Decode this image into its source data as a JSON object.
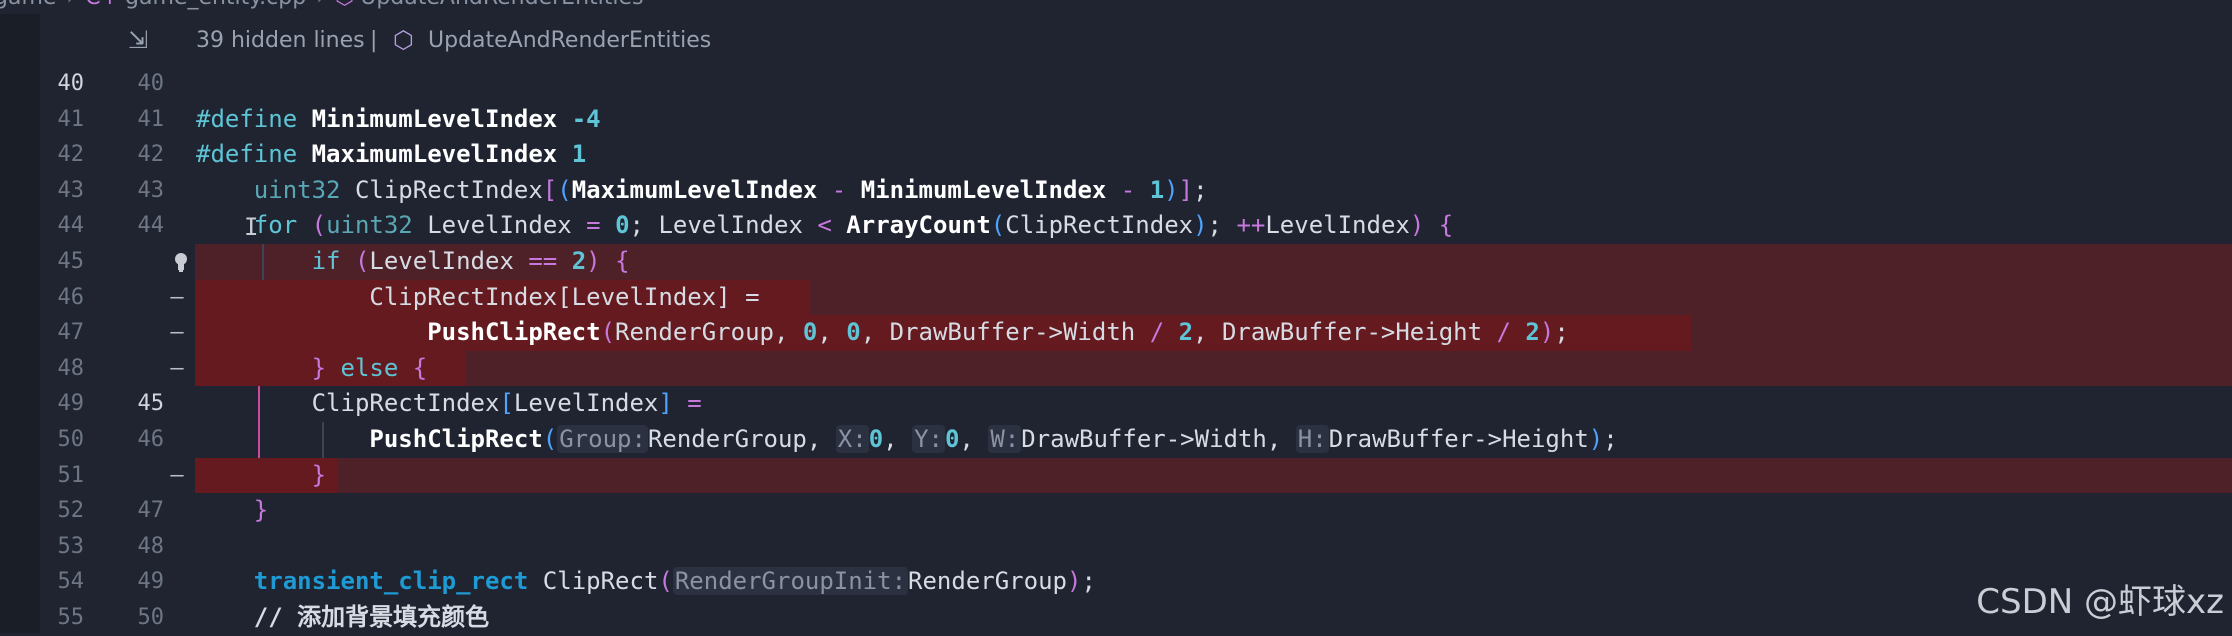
{
  "breadcrumb": {
    "folder": "game",
    "file": "game_entity.cpp",
    "symbol": "UpdateAndRenderEntities"
  },
  "sticky": {
    "hidden_lines": "39 hidden lines",
    "divider": "|",
    "function": "UpdateAndRenderEntities"
  },
  "lines": [
    {
      "left": "40",
      "right": "40"
    },
    {
      "left": "41",
      "right": "41"
    },
    {
      "left": "42",
      "right": "42"
    },
    {
      "left": "43",
      "right": "43"
    },
    {
      "left": "44",
      "right": "44"
    },
    {
      "left": "45",
      "right": ""
    },
    {
      "left": "46",
      "right": "—"
    },
    {
      "left": "47",
      "right": "—"
    },
    {
      "left": "48",
      "right": "—"
    },
    {
      "left": "49",
      "right": "45"
    },
    {
      "left": "50",
      "right": "46"
    },
    {
      "left": "51",
      "right": "—"
    },
    {
      "left": "52",
      "right": "47"
    },
    {
      "left": "53",
      "right": "48"
    },
    {
      "left": "54",
      "right": "49"
    },
    {
      "left": "55",
      "right": "50"
    }
  ],
  "code": {
    "l41_kw": "#define",
    "l41_name": "MinimumLevelIndex",
    "l41_val": "-4",
    "l42_kw": "#define",
    "l42_name": "MaximumLevelIndex",
    "l42_val": "1",
    "l43_type": "uint32",
    "l43_var": "ClipRectIndex",
    "l43_max": "MaximumLevelIndex",
    "l43_min": "MinimumLevelIndex",
    "l43_one": "1",
    "l44_for": "for",
    "l44_type": "uint32",
    "l44_var": "LevelIndex",
    "l44_zero": "0",
    "l44_var2": "LevelIndex",
    "l44_fn": "ArrayCount",
    "l44_arg": "ClipRectIndex",
    "l44_inc": "++",
    "l44_var3": "LevelIndex",
    "l45_if": "if",
    "l45_var": "LevelIndex",
    "l45_two": "2",
    "l46_text": "ClipRectIndex[LevelIndex] =",
    "l47_fn": "PushClipRect",
    "l47_a1": "RenderGroup, ",
    "l47_z1": "0",
    "l47_z2": "0",
    "l47_a2": "DrawBuffer->Width ",
    "l47_d1": "2",
    "l47_a3": "DrawBuffer->Height ",
    "l47_d2": "2",
    "l48_else": "else",
    "l49_var": "ClipRectIndex",
    "l49_idx": "LevelIndex",
    "l50_fn": "PushClipRect",
    "l50_h_group": "Group:",
    "l50_a_group": "RenderGroup",
    "l50_h_x": "X:",
    "l50_x": "0",
    "l50_h_y": "Y:",
    "l50_y": "0",
    "l50_h_w": "W:",
    "l50_w": "DrawBuffer->Width",
    "l50_h_h": "H:",
    "l50_h": "DrawBuffer->Height",
    "l54_type": "transient_clip_rect",
    "l54_fn": "ClipRect",
    "l54_hint": "RenderGroupInit:",
    "l54_arg": "RenderGroup",
    "l55_comment": "// 添加背景填充颜色"
  },
  "watermark": "CSDN @虾球xz",
  "colors": {
    "background": "#1f2430",
    "deleted_line": "#4e2128",
    "deleted_text": "#641a1e",
    "keyword": "#1e9ad4",
    "number": "#5ec4d6",
    "bracket": "#c678dd"
  },
  "icons": [
    "folder-chevron-icon",
    "cpp-file-icon",
    "cube-symbol-icon",
    "collapse-icon",
    "lightbulb-icon",
    "text-cursor-icon"
  ]
}
